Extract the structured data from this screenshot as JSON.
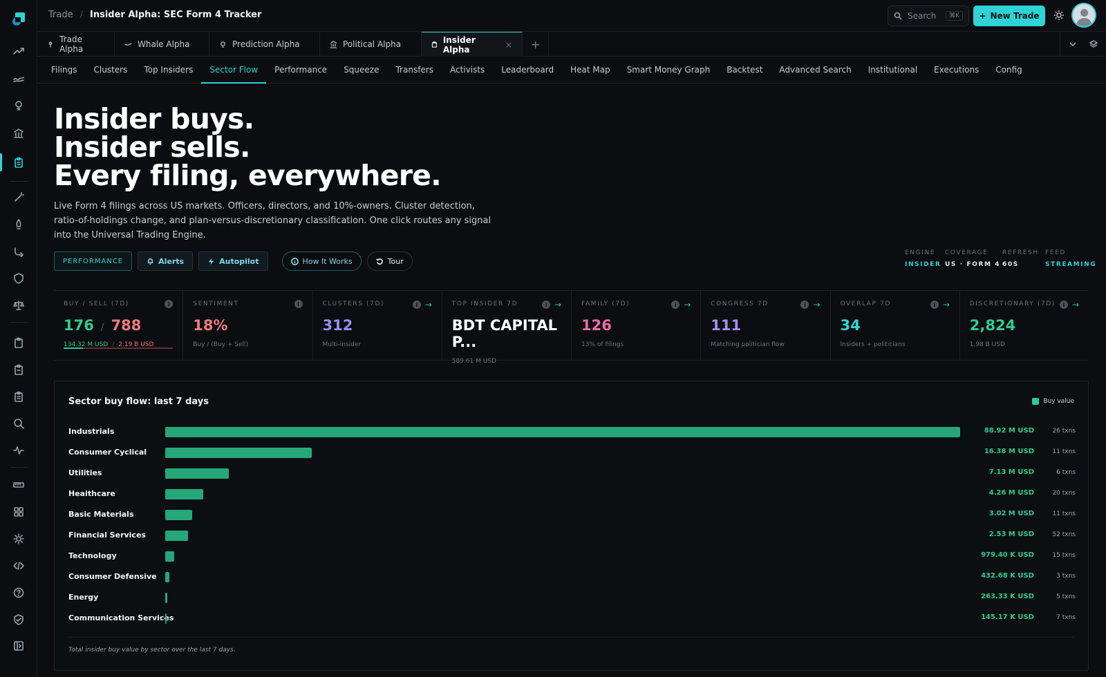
{
  "breadcrumb": {
    "parent": "Trade",
    "current": "Insider Alpha: SEC Form 4 Tracker"
  },
  "topbar": {
    "search_placeholder": "Search",
    "search_shortcut": "⌘K",
    "new_trade_label": "New Trade"
  },
  "tabs": [
    {
      "label": "Trade Alpha",
      "icon": "pin-icon"
    },
    {
      "label": "Whale Alpha",
      "icon": "whale-icon"
    },
    {
      "label": "Prediction Alpha",
      "icon": "bulb-icon"
    },
    {
      "label": "Political Alpha",
      "icon": "bank-icon"
    },
    {
      "label": "Insider Alpha",
      "icon": "clipboard-icon",
      "active": true
    }
  ],
  "subnav": [
    "Filings",
    "Clusters",
    "Top Insiders",
    "Sector Flow",
    "Performance",
    "Squeeze",
    "Transfers",
    "Activists",
    "Leaderboard",
    "Heat Map",
    "Smart Money Graph",
    "Backtest",
    "Advanced Search",
    "Institutional",
    "Executions",
    "Config"
  ],
  "subnav_active": "Sector Flow",
  "hero": {
    "line1": "Insider buys.",
    "line2": "Insider sells.",
    "line3": "Every filing, everywhere.",
    "description": "Live Form 4 filings across US markets. Officers, directors, and 10%-owners. Cluster detection, ratio-of-holdings change, and plan-versus-discretionary classification. One click routes any signal into the Universal Trading Engine."
  },
  "buttons": {
    "performance": "PERFORMANCE",
    "alerts": "Alerts",
    "autopilot": "Autopilot",
    "how": "How It Works",
    "tour": "Tour"
  },
  "meta": [
    {
      "label": "ENGINE",
      "value": "INSIDER",
      "color": "#2dd4d4"
    },
    {
      "label": "COVERAGE",
      "value": "US · FORM 4",
      "color": "#e6e9ee"
    },
    {
      "label": "REFRESH",
      "value": "60S",
      "color": "#e6e9ee"
    },
    {
      "label": "FEED",
      "value": "STREAMING",
      "color": "#2dd4d4"
    }
  ],
  "stats": {
    "buysell": {
      "label": "BUY / SELL (7D)",
      "buy": "176",
      "sell": "788",
      "buy_value": "134.32 M USD",
      "sell_value": "2.19 B USD",
      "buy_fraction": 0.18
    },
    "sentiment": {
      "label": "SENTIMENT",
      "value": "18%",
      "sub": "Buy / (Buy + Sell)"
    },
    "clusters": {
      "label": "CLUSTERS (7D)",
      "value": "312",
      "sub": "Multi-insider"
    },
    "top_insider": {
      "label": "TOP INSIDER 7D",
      "value": "BDT CAPITAL P...",
      "sub": "589.61 M USD"
    },
    "family": {
      "label": "FAMILY (7D)",
      "value": "126",
      "sub": "13% of filings"
    },
    "congress": {
      "label": "CONGRESS 7D",
      "value": "111",
      "sub": "Matching politician flow"
    },
    "overlap": {
      "label": "OVERLAP 7D",
      "value": "34",
      "sub": "Insiders + politicians"
    },
    "discretionary": {
      "label": "DISCRETIONARY (7D)",
      "value": "2,824",
      "sub": "1.98 B USD"
    }
  },
  "sector_panel": {
    "title": "Sector buy flow: last 7 days",
    "legend": "Buy value",
    "footnote": "Total insider buy value by sector over the last 7 days."
  },
  "chart_data": {
    "type": "bar",
    "orientation": "horizontal",
    "series_name": "Buy value",
    "unit": "M USD",
    "categories": [
      "Industrials",
      "Consumer Cyclical",
      "Utilities",
      "Healthcare",
      "Basic Materials",
      "Financial Services",
      "Technology",
      "Consumer Defensive",
      "Energy",
      "Communication Services"
    ],
    "values": [
      88.92,
      16.38,
      7.13,
      4.26,
      3.02,
      2.53,
      0.9794,
      0.43268,
      0.26333,
      0.14517
    ],
    "value_labels": [
      "88.92 M USD",
      "16.38 M USD",
      "7.13 M USD",
      "4.26 M USD",
      "3.02 M USD",
      "2.53 M USD",
      "979.40 K USD",
      "432.68 K USD",
      "263.33 K USD",
      "145.17 K USD"
    ],
    "txns": [
      "26 txns",
      "11 txns",
      "6 txns",
      "20 txns",
      "11 txns",
      "52 txns",
      "15 txns",
      "3 txns",
      "5 txns",
      "7 txns"
    ]
  }
}
